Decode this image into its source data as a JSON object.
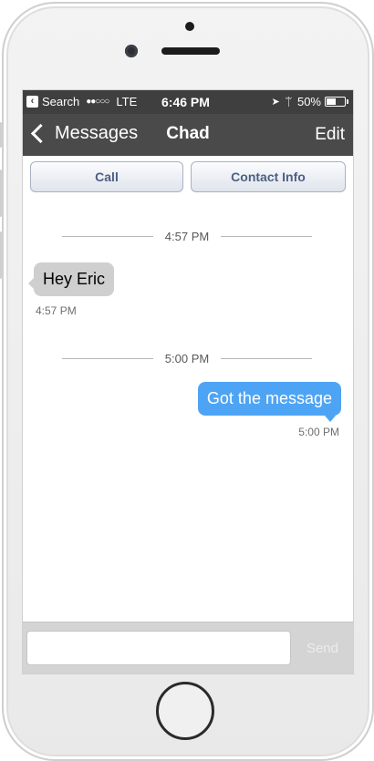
{
  "status_bar": {
    "back_app": "Search",
    "carrier": "LTE",
    "time": "6:46 PM",
    "battery": "50%",
    "battery_level": 0.5
  },
  "nav": {
    "back_label": "Messages",
    "title": "Chad",
    "edit_label": "Edit"
  },
  "actions": {
    "call_label": "Call",
    "contact_info_label": "Contact Info"
  },
  "conversation": [
    {
      "divider": "4:57 PM",
      "direction": "incoming",
      "text": "Hey Eric",
      "timestamp": "4:57 PM"
    },
    {
      "divider": "5:00 PM",
      "direction": "outgoing",
      "text": "Got the message",
      "timestamp": "5:00 PM"
    }
  ],
  "composer": {
    "input_value": "",
    "send_label": "Send"
  },
  "colors": {
    "outgoing_bubble": "#4ea4f4",
    "incoming_bubble": "#cfcfcf",
    "nav_bar": "#4a4a4a",
    "button_text": "#4d5f82"
  }
}
